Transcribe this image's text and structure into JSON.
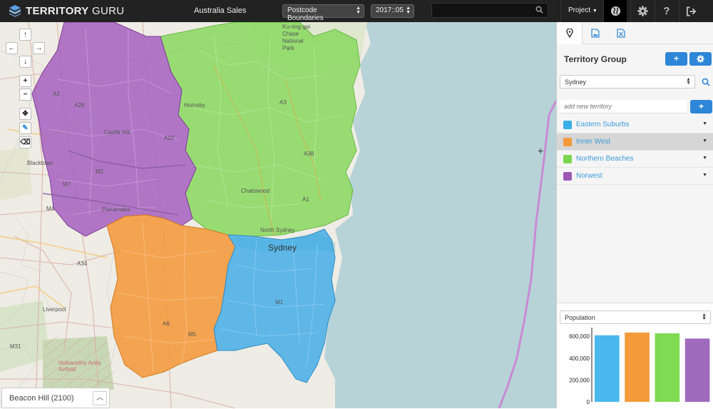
{
  "header": {
    "logo_bold": "TERRITORY",
    "logo_light": " GURU",
    "title": "Australia Sales",
    "boundary_select": "Postcode Boundaries",
    "date_select": "2017::05",
    "search_value": "",
    "project_label": "Project",
    "icons": [
      "globe-icon",
      "gear-icon",
      "help-icon",
      "logout-icon"
    ]
  },
  "map": {
    "place_labels": {
      "sydney": "Sydney",
      "castle_hill": "Castle Hill",
      "hornsby": "Hornsby",
      "chatswood": "Chatswood",
      "parramatta": "Parramatta",
      "blacktown": "Blacktown",
      "liverpool": "Liverpool",
      "north_sydney": "North Sydney",
      "ku_ring_gai": "Ku-ring-gai Chase National Park",
      "holsworthy": "Holsworthy Army Airfield"
    },
    "road_labels": [
      "A2",
      "M2",
      "M4",
      "A3",
      "A1",
      "A6",
      "M1",
      "A38",
      "M5",
      "M31",
      "A28",
      "A22",
      "A34",
      "M7"
    ],
    "controls": [
      "pan-up",
      "pan-left",
      "pan-right",
      "pan-down",
      "zoom-in",
      "zoom-out",
      "move",
      "draw",
      "erase"
    ],
    "status_text": "Beacon Hill (2100)"
  },
  "panel": {
    "tabs": [
      "location-tab",
      "image-tab",
      "excel-tab"
    ],
    "group_title": "Territory Group",
    "group_select": "Sydney",
    "new_territory_placeholder": "add new territory",
    "territories": [
      {
        "name": "Eastern Suburbs",
        "color": "#3aaee8"
      },
      {
        "name": "Inner West",
        "color": "#f39a3a"
      },
      {
        "name": "Northern Beaches",
        "color": "#79d64f"
      },
      {
        "name": "Norwest",
        "color": "#9b59b6"
      }
    ],
    "metric_select": "Population"
  },
  "chart_data": {
    "type": "bar",
    "categories": [
      "Eastern Suburbs",
      "Inner West",
      "Northern Beaches",
      "Norwest"
    ],
    "values": [
      610000,
      635000,
      628000,
      580000
    ],
    "colors": [
      "#4ab8ec",
      "#f39a3a",
      "#7edb52",
      "#a06bbd"
    ],
    "yticks": [
      "600,000",
      "400,000",
      "200,000",
      "0"
    ],
    "ytick_values": [
      600000,
      400000,
      200000,
      0
    ],
    "ylim": [
      0,
      680000
    ]
  }
}
